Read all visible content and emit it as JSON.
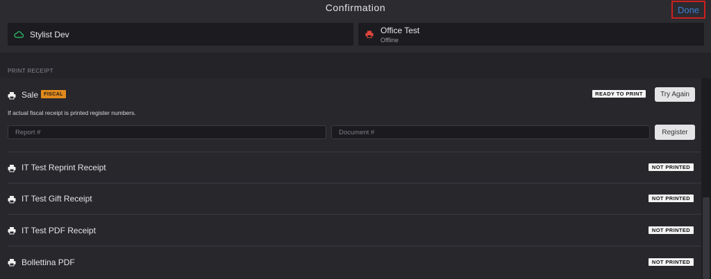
{
  "header": {
    "title": "Confirmation",
    "done_label": "Done"
  },
  "devices": [
    {
      "name": "Stylist Dev",
      "status": "",
      "icon": "cloud-icon",
      "color": "#2ecc71"
    },
    {
      "name": "Office Test",
      "status": "Offline",
      "icon": "printer-icon",
      "color": "#e0443c"
    }
  ],
  "section": {
    "label": "PRINT RECEIPT"
  },
  "sale": {
    "label": "Sale",
    "fiscal_badge": "FISCAL",
    "status_badge": "READY TO PRINT",
    "try_again_label": "Try Again",
    "info_text": "If actual fiscal receipt is printed register numbers.",
    "report_placeholder": "Report #",
    "document_placeholder": "Document #",
    "register_label": "Register"
  },
  "receipts": [
    {
      "label": "IT Test Reprint Receipt",
      "status": "NOT PRINTED"
    },
    {
      "label": "IT Test Gift Receipt",
      "status": "NOT PRINTED"
    },
    {
      "label": "IT Test PDF Receipt",
      "status": "NOT PRINTED"
    },
    {
      "label": "Bollettina PDF",
      "status": "NOT PRINTED"
    }
  ]
}
